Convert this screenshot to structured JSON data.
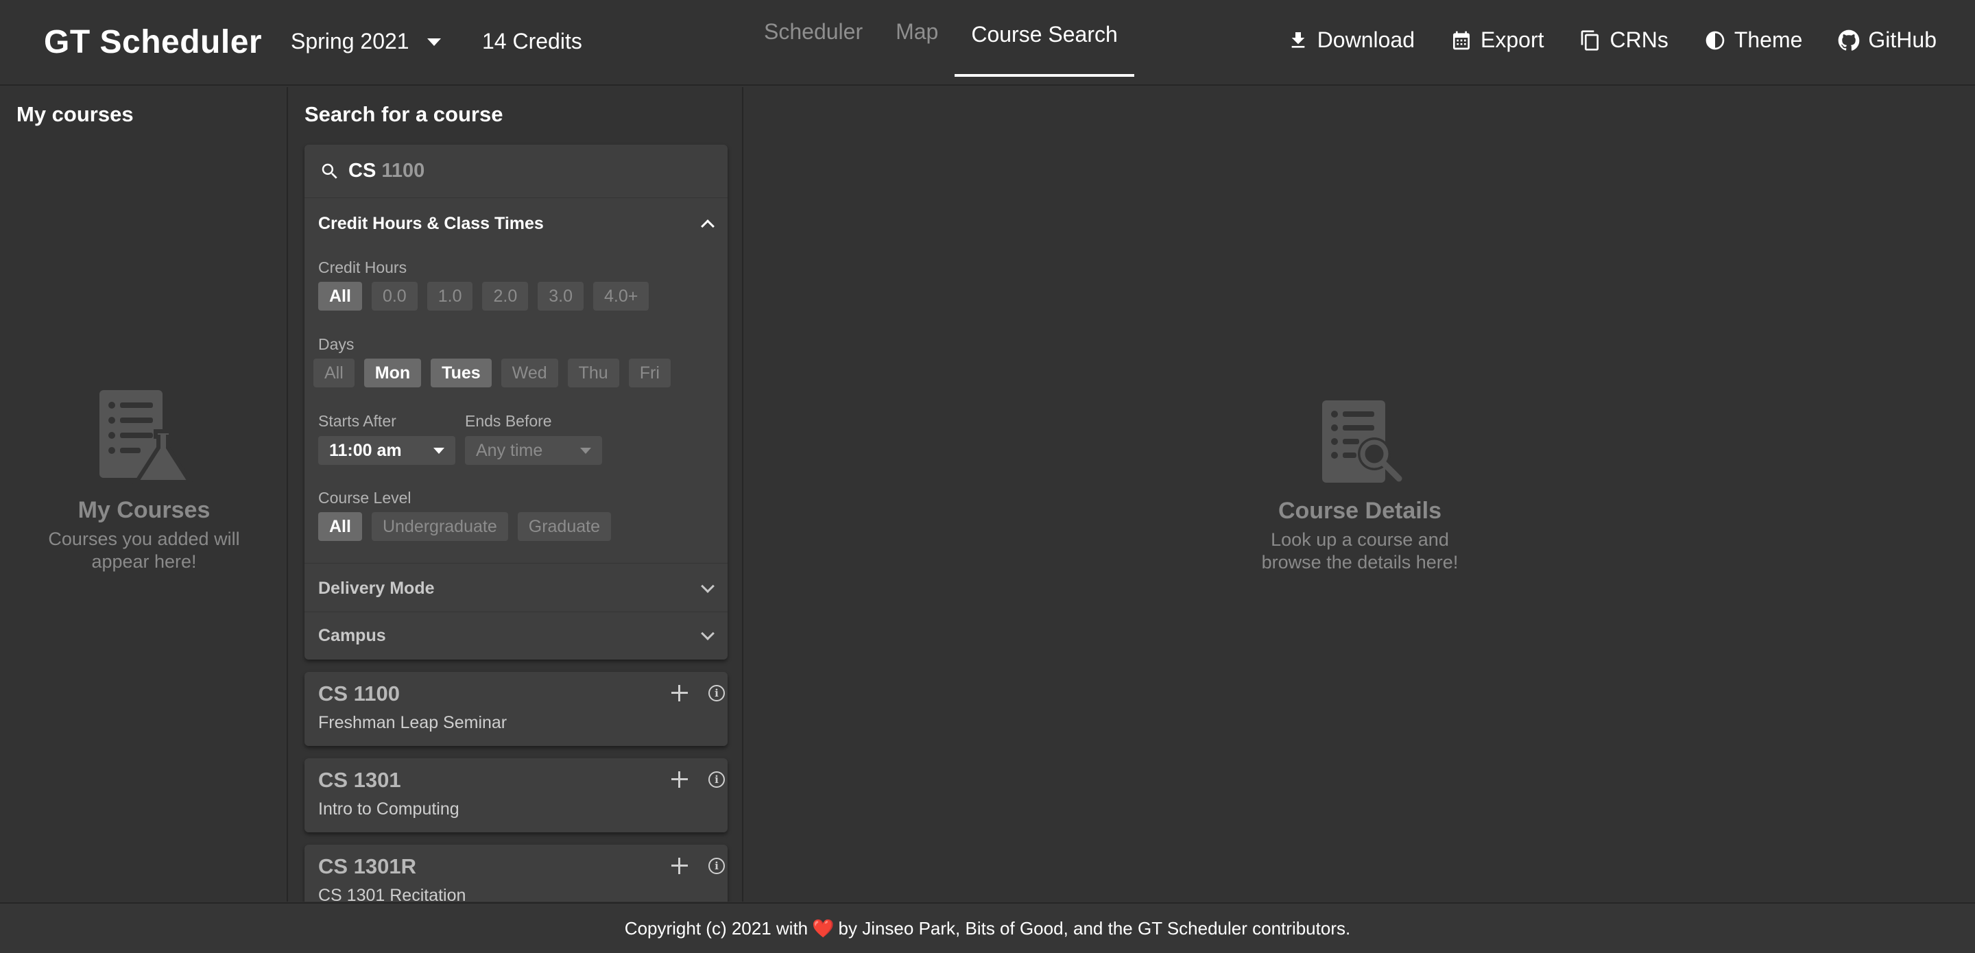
{
  "header": {
    "brand": "GT Scheduler",
    "term": "Spring 2021",
    "credits": "14 Credits",
    "tabs": [
      {
        "label": "Scheduler",
        "active": false
      },
      {
        "label": "Map",
        "active": false
      },
      {
        "label": "Course Search",
        "active": true
      }
    ],
    "actions": [
      {
        "label": "Download",
        "icon": "download-icon"
      },
      {
        "label": "Export",
        "icon": "calendar-icon"
      },
      {
        "label": "CRNs",
        "icon": "copy-icon"
      },
      {
        "label": "Theme",
        "icon": "theme-icon"
      },
      {
        "label": "GitHub",
        "icon": "github-icon"
      }
    ]
  },
  "my_courses": {
    "title": "My courses",
    "empty_title": "My Courses",
    "empty_desc_line1": "Courses you added will",
    "empty_desc_line2": "appear here!",
    "icon": "course-list-flask-icon"
  },
  "search": {
    "title": "Search for a course",
    "query_typed": "CS",
    "query_suggestion": " 1100",
    "filters_section": "Credit Hours & Class Times",
    "credit_hours": {
      "label": "Credit Hours",
      "options": [
        "All",
        "0.0",
        "1.0",
        "2.0",
        "3.0",
        "4.0+"
      ],
      "selected": [
        "All"
      ]
    },
    "days": {
      "label": "Days",
      "options": [
        "All",
        "Mon",
        "Tues",
        "Wed",
        "Thu",
        "Fri"
      ],
      "selected": [
        "Mon",
        "Tues"
      ]
    },
    "starts_after": {
      "label": "Starts After",
      "value": "11:00 am"
    },
    "ends_before": {
      "label": "Ends Before",
      "value": "Any time"
    },
    "course_level": {
      "label": "Course Level",
      "options": [
        "All",
        "Undergraduate",
        "Graduate"
      ],
      "selected": [
        "All"
      ]
    },
    "delivery_mode": "Delivery Mode",
    "campus": "Campus"
  },
  "results": [
    {
      "code": "CS 1100",
      "name": "Freshman Leap Seminar"
    },
    {
      "code": "CS 1301",
      "name": "Intro to Computing"
    },
    {
      "code": "CS 1301R",
      "name": "CS 1301 Recitation"
    }
  ],
  "course_details": {
    "empty_title": "Course Details",
    "empty_desc_line1": "Look up a course and",
    "empty_desc_line2": "browse the details here!",
    "icon": "document-search-icon"
  },
  "footer": {
    "before": "Copyright (c) 2021 with",
    "heart": "❤️",
    "after": "by Jinseo Park, Bits of Good, and the GT Scheduler contributors."
  },
  "colors": {
    "background": "#333333",
    "card": "#3f3f3f",
    "chip": "#4e4e4e",
    "chip_selected": "#6a6a6a",
    "muted_text": "#8a8a8a"
  }
}
